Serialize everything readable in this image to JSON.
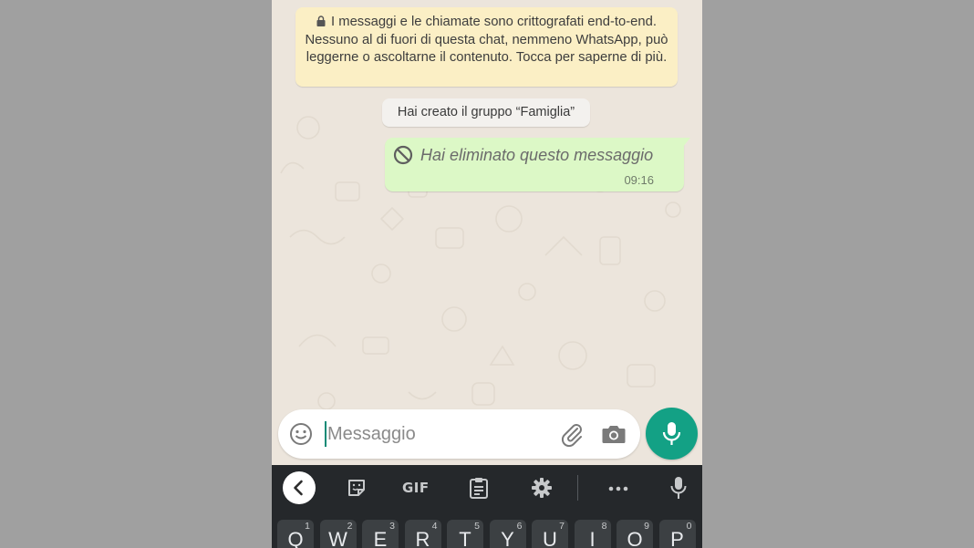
{
  "chat": {
    "encryption_notice": "I messaggi e le chiamate sono crittografati end-to-end. Nessuno al di fuori di questa chat, nemmeno WhatsApp, può leggerne o ascoltarne il contenuto. Tocca per saperne di più.",
    "system_message": "Hai creato il gruppo “Famiglia”",
    "messages": [
      {
        "text": "Hai eliminato questo messaggio",
        "time": "09:16"
      }
    ]
  },
  "composer": {
    "placeholder": "Messaggio"
  },
  "keyboard": {
    "toolbar": {
      "gif_label": "GIF"
    },
    "keys": [
      {
        "letter": "Q",
        "num": "1"
      },
      {
        "letter": "W",
        "num": "2"
      },
      {
        "letter": "E",
        "num": "3"
      },
      {
        "letter": "R",
        "num": "4"
      },
      {
        "letter": "T",
        "num": "5"
      },
      {
        "letter": "Y",
        "num": "6"
      },
      {
        "letter": "U",
        "num": "7"
      },
      {
        "letter": "I",
        "num": "8"
      },
      {
        "letter": "O",
        "num": "9"
      },
      {
        "letter": "P",
        "num": "0"
      }
    ]
  },
  "colors": {
    "accent_green": "#13a185",
    "outgoing_bubble": "#dcf8c6",
    "notice_yellow": "#fbefc5",
    "chat_background": "#ece5dc",
    "keyboard_background": "#25282b"
  }
}
